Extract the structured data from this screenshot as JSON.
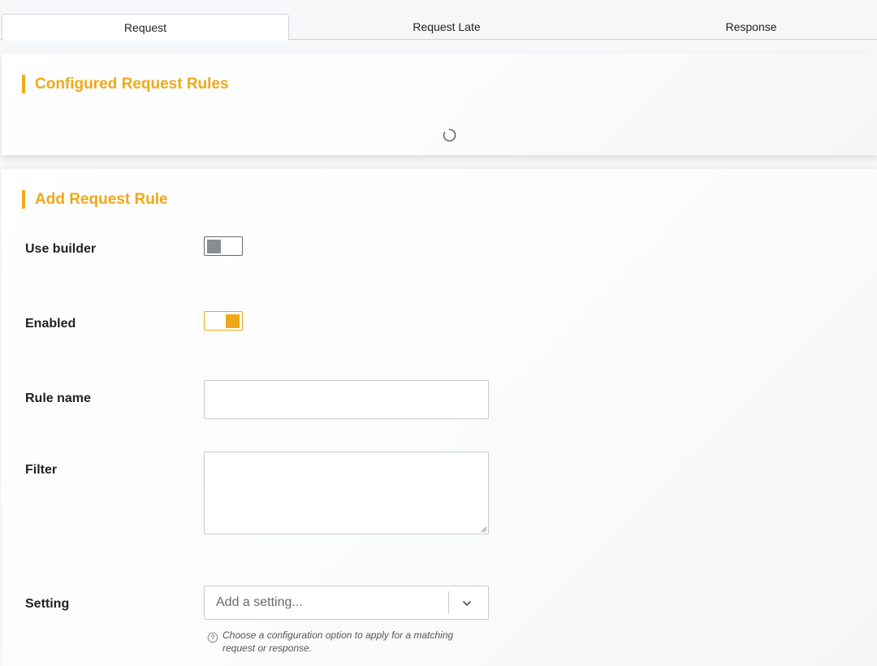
{
  "tabs": {
    "request": "Request",
    "request_late": "Request Late",
    "response": "Response",
    "active": "request"
  },
  "configured": {
    "title": "Configured Request Rules",
    "loading_icon": "spinner-icon"
  },
  "add_rule": {
    "title": "Add Request Rule",
    "use_builder": {
      "label": "Use builder",
      "checked": false
    },
    "enabled": {
      "label": "Enabled",
      "checked": true
    },
    "rule_name": {
      "label": "Rule name",
      "value": "",
      "placeholder": ""
    },
    "filter": {
      "label": "Filter",
      "value": "",
      "placeholder": ""
    },
    "setting": {
      "label": "Setting",
      "placeholder": "Add a setting...",
      "help": "Choose a configuration option to apply for a matching request or response.",
      "icon": "chevron-down-icon"
    }
  },
  "colors": {
    "accent": "#f0a818",
    "toggle_off": "#8a8d90",
    "border": "#c8cbce",
    "text": "#222222"
  }
}
